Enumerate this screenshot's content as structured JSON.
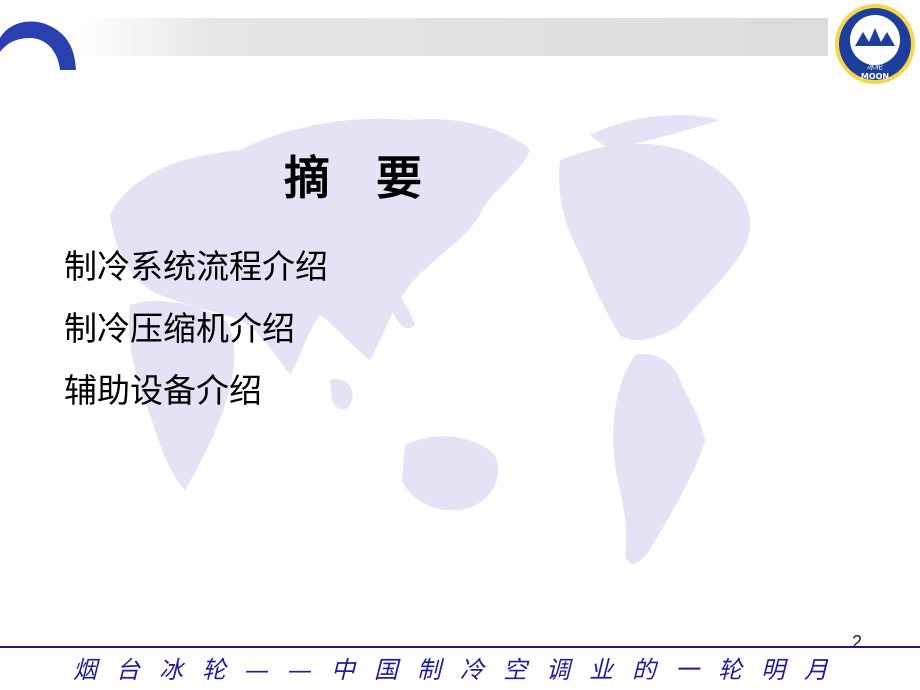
{
  "slide": {
    "title": "摘　要",
    "items": [
      {
        "label": "制冷系统流程介绍"
      },
      {
        "label": "制冷压缩机介绍"
      },
      {
        "label": "辅助设备介绍"
      }
    ],
    "page_number": "2"
  },
  "logo": {
    "text_top": "冰轮",
    "text_bottom": "MOON"
  },
  "footer": {
    "slogan": "烟台冰轮——中国制冷空调业的一轮明月"
  },
  "colors": {
    "map_fill": "#e3e3f5",
    "logo_blue": "#1c3f9e",
    "accent_blue": "#2a3fb0",
    "footer_blue": "#1d1d9e",
    "top_bar_gray": "#dcdcdc"
  },
  "icons": [
    "corner-arc-icon",
    "moon-logo-icon",
    "world-map-icon"
  ]
}
